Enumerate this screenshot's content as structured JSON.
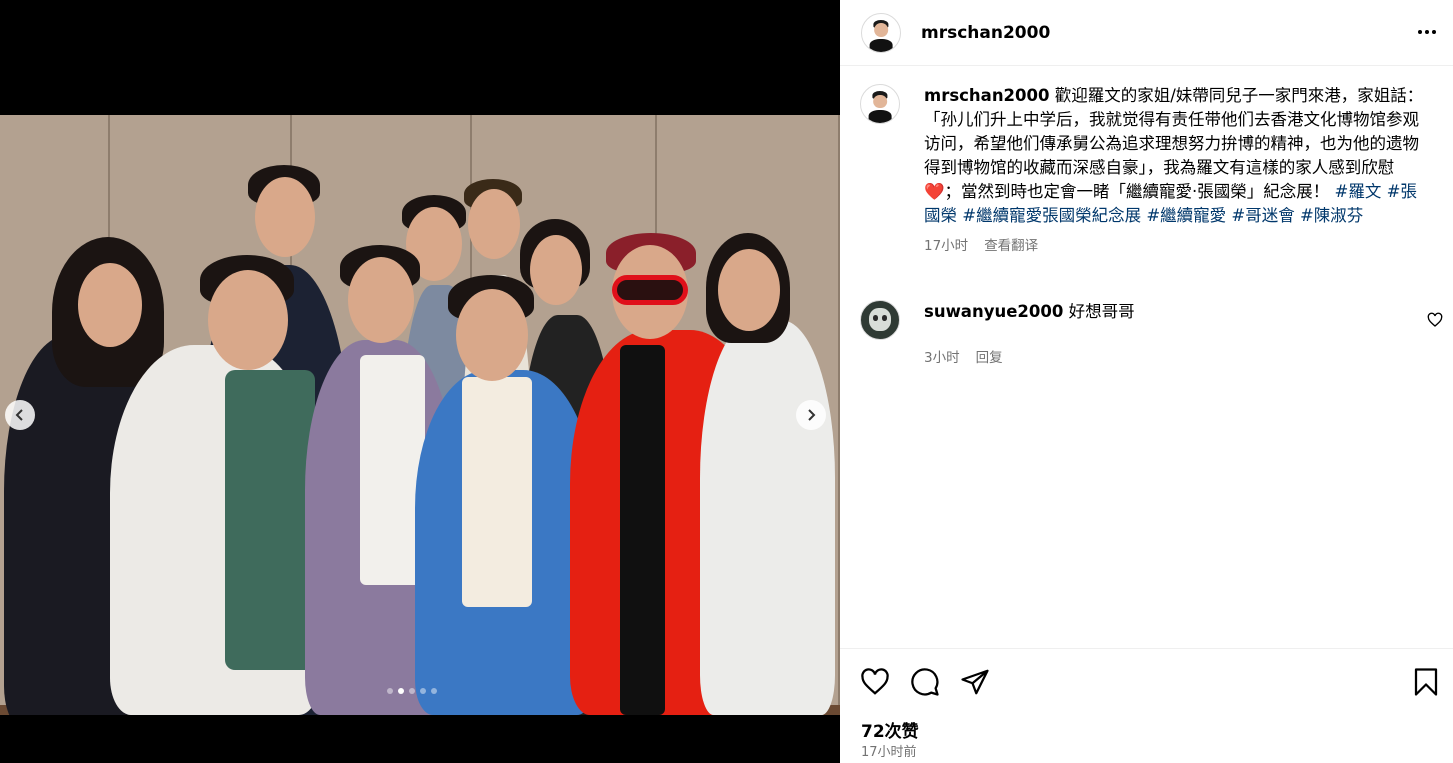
{
  "post": {
    "author": "mrschan2000",
    "more_options_icon": "more-horizontal-icon"
  },
  "media": {
    "prev_icon": "chevron-left-icon",
    "next_icon": "chevron-right-icon",
    "carousel_total": 5,
    "carousel_active_index": 1
  },
  "caption": {
    "username": "mrschan2000",
    "text_before_heart": "歡迎羅文的家姐/妹帶同兒子一家門來港，家姐話：「孙儿们升上中学后，我就觉得有责任带他们去香港文化博物馆参观访问，希望他们傳承舅公為追求理想努力拚博的精神，也为他的遗物得到博物馆的收藏而深感自豪」，我為羅文有這樣的家人感到欣慰",
    "heart_emoji": "❤️",
    "text_after_heart": "；當然到時也定會一睹「繼續寵愛·張國榮」紀念展！",
    "hashtags": [
      "#羅文",
      "#張國榮",
      "#繼續寵愛張國榮紀念展",
      "#繼續寵愛",
      "#哥迷會",
      "#陳淑芬"
    ],
    "time": "17小时",
    "see_translation": "查看翻译"
  },
  "comment": {
    "username": "suwanyue2000",
    "text": "好想哥哥",
    "time": "3小时",
    "reply": "回复"
  },
  "actions": {
    "like_icon": "heart-icon",
    "comment_icon": "comment-icon",
    "share_icon": "send-icon",
    "save_icon": "bookmark-icon",
    "likes_count": "72次赞",
    "posted": "17小时前"
  },
  "colors": {
    "hashtag": "#00376b",
    "secondary_text": "#737373",
    "divider": "#efefef"
  }
}
